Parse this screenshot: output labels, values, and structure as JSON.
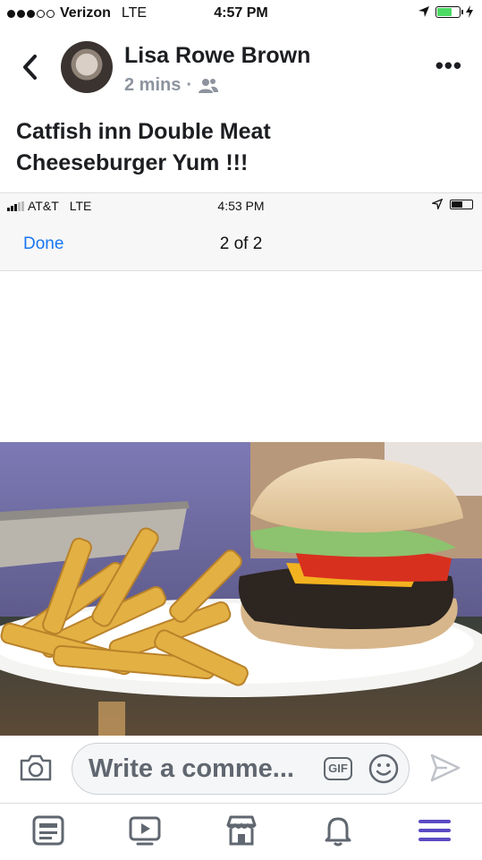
{
  "status_bar": {
    "carrier": "Verizon",
    "network": "LTE",
    "time": "4:57 PM"
  },
  "post": {
    "author": "Lisa Rowe Brown",
    "time": "2 mins",
    "separator": "·",
    "audience_icon": "friends-icon",
    "text": "Catfish inn Double Meat\nCheeseburger Yum !!!"
  },
  "inner_screenshot": {
    "carrier": "AT&T",
    "network": "LTE",
    "time": "4:53 PM",
    "done_label": "Done",
    "counter": "2 of 2"
  },
  "photo": {
    "description_icon": "burger-and-fries-photo"
  },
  "comment_bar": {
    "placeholder": "Write a comme...",
    "gif_label": "GIF"
  },
  "tab_bar": {
    "items": [
      "news-feed-icon",
      "watch-icon",
      "marketplace-icon",
      "notifications-icon",
      "menu-icon"
    ]
  },
  "colors": {
    "accent": "#1877f2",
    "menu_active": "#5b4bc4",
    "battery_green": "#4cd964"
  }
}
